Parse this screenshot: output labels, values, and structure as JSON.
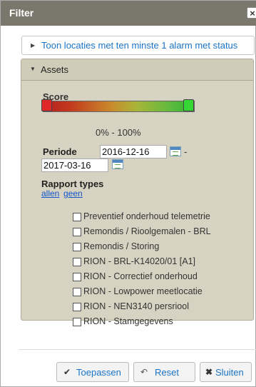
{
  "dialog": {
    "title": "Filter",
    "close_glyph": "×"
  },
  "accordion": {
    "alarm_section": {
      "label": "Toon locaties met ten minste 1 alarm met status",
      "expanded": false
    },
    "assets_section": {
      "label": "Assets",
      "expanded": true
    }
  },
  "score": {
    "label": "Score",
    "range_text": "0% - 100%",
    "min_value": 0,
    "max_value": 100,
    "colors": {
      "low": "#e02828",
      "high": "#37d637"
    }
  },
  "periode": {
    "label": "Periode",
    "start": "2016-12-16",
    "separator": "-",
    "end": "2017-03-16"
  },
  "report_types": {
    "label": "Rapport types",
    "select_all": "allen",
    "select_none": "geen",
    "items": [
      {
        "label": "Preventief onderhoud telemetrie",
        "checked": false
      },
      {
        "label": "Remondis / Rioolgemalen - BRL",
        "checked": false
      },
      {
        "label": "Remondis / Storing",
        "checked": false
      },
      {
        "label": "RION - BRL-K14020/01 [A1]",
        "checked": false
      },
      {
        "label": "RION - Correctief onderhoud",
        "checked": false
      },
      {
        "label": "RION - Lowpower meetlocatie",
        "checked": false
      },
      {
        "label": "RION - NEN3140 persriool",
        "checked": false
      },
      {
        "label": "RION - Stamgegevens",
        "checked": false
      }
    ]
  },
  "footer": {
    "apply": {
      "label": "Toepassen",
      "icon": "check-icon"
    },
    "reset": {
      "label": "Reset",
      "icon": "undo-icon"
    },
    "close": {
      "label": "Sluiten",
      "icon": "close-icon"
    }
  }
}
